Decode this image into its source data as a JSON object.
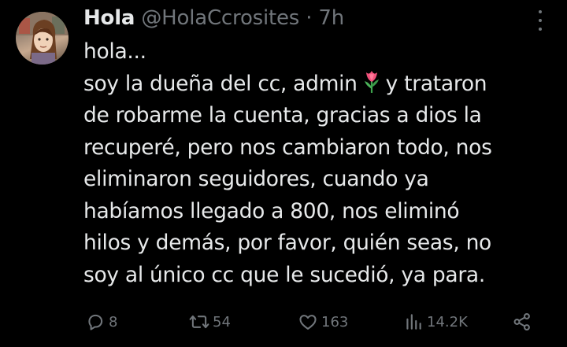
{
  "tweet": {
    "display_name": "Hola",
    "handle": "@HolaCcrosites",
    "separator": "·",
    "time": "7h",
    "lines": [
      "hola...",
      "soy la dueña del cc, admin",
      "y trataron",
      "de robarme la cuenta, gracias a dios la",
      "recuperé, pero nos cambiaron todo, nos",
      "eliminaron seguidores, cuando ya",
      "habíamos llegado a 800, nos eliminó",
      "hilos y demás, por favor, quién seas, no",
      "soy al único cc que le sucedió, ya para."
    ],
    "emoji": "tulip-emoji"
  },
  "actions": {
    "replies": "8",
    "reposts": "54",
    "likes": "163",
    "views": "14.2K"
  },
  "colors": {
    "background": "#000000",
    "text": "#e7e9ea",
    "secondary": "#71767b"
  }
}
